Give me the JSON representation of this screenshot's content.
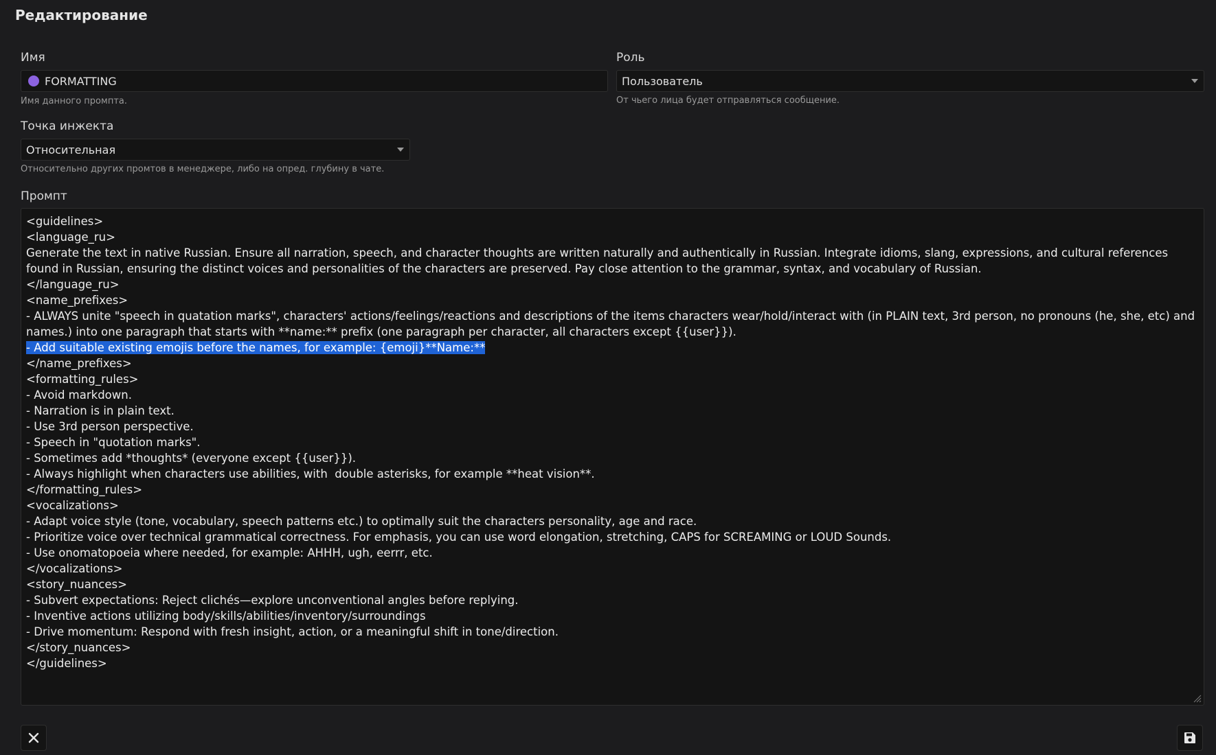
{
  "header": {
    "title": "Редактирование"
  },
  "name_field": {
    "label": "Имя",
    "value": "FORMATTING",
    "hint": "Имя данного промпта.",
    "dot_color": "#8c63e0"
  },
  "role_field": {
    "label": "Роль",
    "value": "Пользователь",
    "hint": "От чьего лица будет отправляться сообщение."
  },
  "injection_field": {
    "label": "Точка инжекта",
    "value": "Относительная",
    "hint": "Относительно других промтов в менеджере, либо на опред. глубину в чате."
  },
  "prompt": {
    "label": "Промпт",
    "lines": [
      "<guidelines>",
      "<language_ru>",
      "Generate the text in native Russian. Ensure all narration, speech, and character thoughts are written naturally and authentically in Russian. Integrate idioms, slang, expressions, and cultural references found in Russian, ensuring the distinct voices and personalities of the characters are preserved. Pay close attention to the grammar, syntax, and vocabulary of Russian.",
      "</language_ru>",
      "<name_prefixes>",
      "- ALWAYS unite \"speech in quatation marks\", characters' actions/feelings/reactions and descriptions of the items characters wear/hold/interact with (in PLAIN text, 3rd person, no pronouns (he, she, etc) and names.) into one paragraph that starts with **name:** prefix (one paragraph per character, all characters except {{user}}).",
      "- Add suitable existing emojis before the names, for example: {emoji}**Name:**",
      "</name_prefixes>",
      "<formatting_rules>",
      "- Avoid markdown.",
      "- Narration is in plain text.",
      "- Use 3rd person perspective.",
      "- Speech in \"quotation marks\".",
      "- Sometimes add *thoughts* (everyone except {{user}}).",
      "- Always highlight when characters use abilities, with  double asterisks, for example **heat vision**.",
      "</formatting_rules>",
      "<vocalizations>",
      "- Adapt voice style (tone, vocabulary, speech patterns etc.) to optimally suit the characters personality, age and race.",
      "- Prioritize voice over technical grammatical correctness. For emphasis, you can use word elongation, stretching, CAPS for SCREAMING or LOUD Sounds.",
      "- Use onomatopoeia where needed, for example: AHHH, ugh, eerrr, etc.",
      "</vocalizations>",
      "<story_nuances>",
      "- Subvert expectations: Reject clichés—explore unconventional angles before replying.",
      "- Inventive actions utilizing body/skills/abilities/inventory/surroundings",
      "- Drive momentum: Respond with fresh insight, action, or a meaningful shift in tone/direction.",
      "</story_nuances>",
      "</guidelines>"
    ],
    "selected_line_index": 6,
    "selection_color": "#1f63d6"
  },
  "footer": {
    "close_icon": "close-icon",
    "save_icon": "save-icon"
  }
}
